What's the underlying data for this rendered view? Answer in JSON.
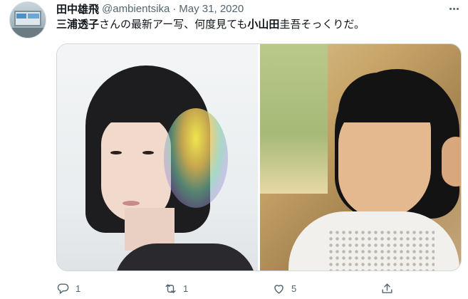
{
  "tweet": {
    "author_name": "田中雄飛",
    "handle": "@ambientsika",
    "separator": "·",
    "date": "May 31, 2020",
    "text_parts": {
      "p1": "三浦透子",
      "p2": "さんの最新アー写、何度見ても",
      "p3": "小山田",
      "p4": "圭吾そっくりだ。"
    },
    "media": {
      "left_icon": "person-photo",
      "right_icon": "person-photo"
    },
    "actions": {
      "reply_count": "1",
      "retweet_count": "1",
      "like_count": "5"
    }
  },
  "icons": {
    "more": "more-horizontal-icon",
    "reply": "reply-icon",
    "retweet": "retweet-icon",
    "like": "heart-icon",
    "share": "share-icon"
  },
  "colors": {
    "text_primary": "#0f1419",
    "text_secondary": "#536471",
    "border": "#cfd9de"
  }
}
